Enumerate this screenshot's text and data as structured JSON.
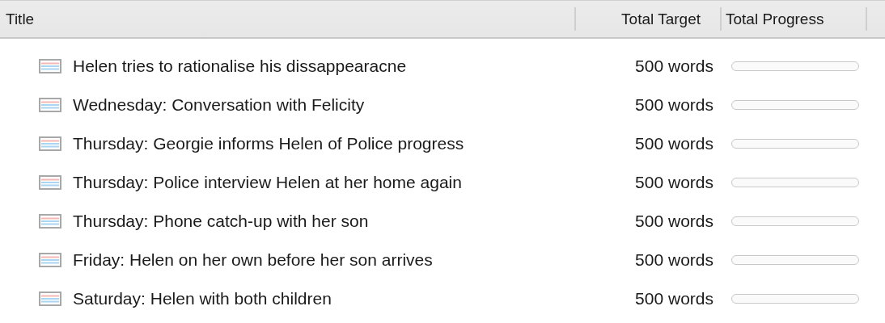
{
  "table": {
    "columns": [
      "Title",
      "Total Target",
      "Total Progress"
    ],
    "rows": [
      {
        "title": "Helen tries to rationalise his dissappearacne",
        "target": "500 words",
        "level": 0
      },
      {
        "title": "Wednesday: Conversation with Felicity",
        "target": "500 words",
        "level": 0
      },
      {
        "title": "Thursday: Georgie informs Helen of Police progress",
        "target": "500 words",
        "level": 0
      },
      {
        "title": "Thursday: Police interview Helen at her home again",
        "target": "500 words",
        "level": 0
      },
      {
        "title": "Thursday: Phone catch-up with her son",
        "target": "500 words",
        "level": 0
      },
      {
        "title": "Friday: Helen on her own before her son arrives",
        "target": "500 words",
        "level": 0
      },
      {
        "title": "Saturday: Helen with both children",
        "target": "500 words",
        "level": 0
      }
    ]
  }
}
